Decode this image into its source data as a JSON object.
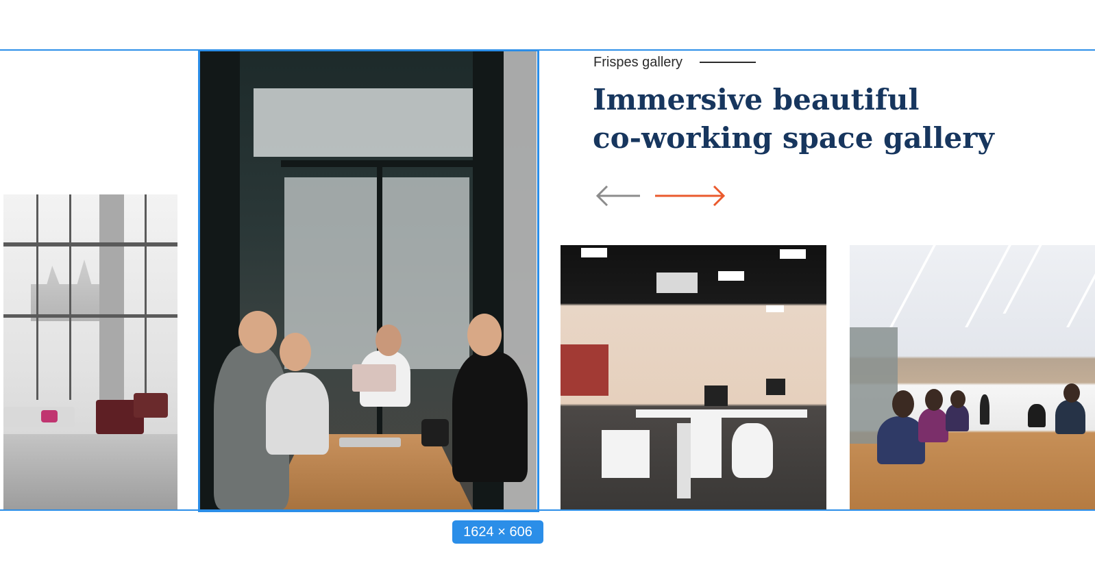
{
  "section": {
    "eyebrow": "Frispes gallery",
    "headline_line1": "Immersive beautiful",
    "headline_line2": "co-working space gallery"
  },
  "navigation": {
    "prev_icon": "arrow-left-icon",
    "next_icon": "arrow-right-icon",
    "prev_color": "#8c8c8c",
    "next_color": "#ea5a2d"
  },
  "selection": {
    "dimensions_label": "1624 × 606",
    "highlight_color": "#2b8ee8"
  },
  "brand": {
    "headline_color": "#17365e"
  }
}
